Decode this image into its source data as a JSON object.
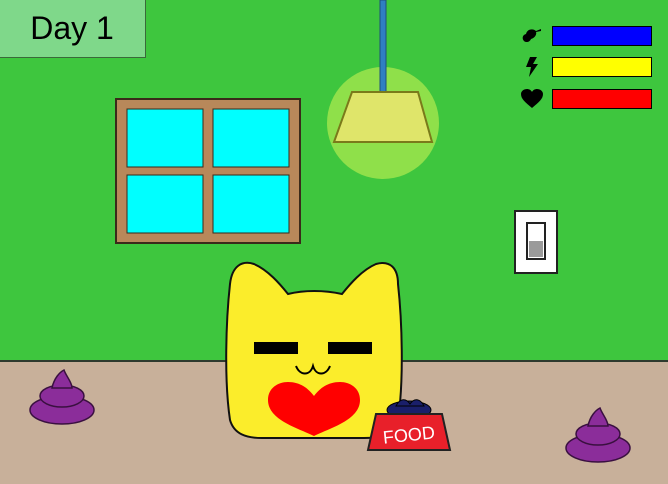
{
  "day_label": "Day 1",
  "food_bowl": {
    "label": "FOOD"
  },
  "stats": [
    {
      "name": "hunger",
      "icon": "drumstick-icon",
      "color": "#0000ff",
      "level": 1.0
    },
    {
      "name": "energy",
      "icon": "lightning-icon",
      "color": "#ffff00",
      "level": 1.0
    },
    {
      "name": "health",
      "icon": "heart-icon",
      "color": "#ff0000",
      "level": 1.0
    }
  ],
  "colors": {
    "wall": "#3ec63e",
    "floor": "#c8b09a",
    "cat": "#fbed2b",
    "poop": "#8b2d9a",
    "bowl": "#e8202a",
    "window_glass": "#00ffff",
    "window_frame": "#b8885a"
  }
}
